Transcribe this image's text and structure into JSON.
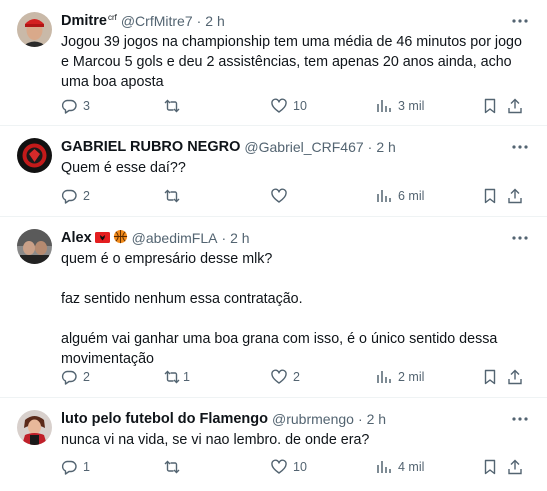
{
  "colors": {
    "text": "#0f1419",
    "secondary": "#536471",
    "divider": "#eff3f4"
  },
  "tweets": [
    {
      "name": "Dmitre",
      "badge": "crf",
      "handle": "@CrfMitre7",
      "sep": "·",
      "time": "2 h",
      "text": "Jogou 39 jogos na championship tem uma média de 46 minutos por jogo e Marcou 5 gols e deu 2 assistências, tem apenas 20 anos ainda, acho uma boa aposta",
      "replies": "3",
      "retweets": "",
      "likes": "10",
      "views": "3 mil"
    },
    {
      "name": "GABRIEL RUBRO NEGRO",
      "handle": "@Gabriel_CRF467",
      "sep": "·",
      "time": "2 h",
      "text": "Quem é esse daí??",
      "replies": "2",
      "retweets": "",
      "likes": "",
      "views": "6 mil"
    },
    {
      "name": "Alex",
      "handle": "@abedimFLA",
      "sep": "·",
      "time": "2 h",
      "text": "quem é o empresário desse mlk?\n\nfaz sentido nenhum essa contratação.\n\nalguém vai ganhar uma boa grana com isso, é o único sentido dessa movimentação",
      "replies": "2",
      "retweets": "1",
      "likes": "2",
      "views": "2 mil"
    },
    {
      "name": "luto pelo futebol do Flamengo",
      "handle": "@rubrmengo",
      "sep": "·",
      "time": "2 h",
      "text": "nunca vi na vida, se vi nao lembro. de onde era?",
      "replies": "1",
      "retweets": "",
      "likes": "10",
      "views": "4 mil"
    }
  ]
}
